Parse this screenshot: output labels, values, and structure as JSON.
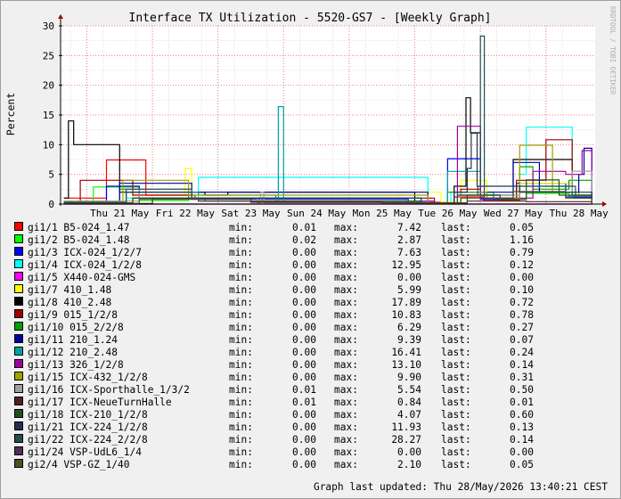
{
  "chart_data": {
    "type": "line",
    "title": "Interface TX Utilization - 5520-GS7 - [Weekly Graph]",
    "ylabel": "Percent",
    "xlabel": "",
    "ylim": [
      0,
      30
    ],
    "yticks": [
      0,
      5,
      10,
      15,
      20,
      25,
      30
    ],
    "xlim": [
      -0.9,
      7.25
    ],
    "x_ticks": [
      {
        "label": "Thu 21 May",
        "day": 0
      },
      {
        "label": "Fri 22 May",
        "day": 1
      },
      {
        "label": "Sat 23 May",
        "day": 2
      },
      {
        "label": "Sun 24 May",
        "day": 3
      },
      {
        "label": "Mon 25 May",
        "day": 4
      },
      {
        "label": "Tue 26 May",
        "day": 5
      },
      {
        "label": "Wed 27 May",
        "day": 6
      },
      {
        "label": "Thu 28 May",
        "day": 7
      }
    ],
    "grid": true,
    "watermark": "RRDTOOL / TOBI OETIKER",
    "series": [
      {
        "name": "gi1/1 B5-024_1.47",
        "color": "#FF0000",
        "min": "0.01",
        "max": "7.42",
        "last": "0.05",
        "x": [
          -0.85,
          -0.2,
          0.4,
          1.15,
          4.6,
          5.1,
          5.55,
          6.1,
          6.9,
          7.2
        ],
        "y": [
          1.0,
          7.42,
          1.5,
          1.0,
          0.3,
          1.2,
          0.6,
          2.0,
          1.0,
          0.05
        ]
      },
      {
        "name": "gi1/2 B5-024_1.48",
        "color": "#00FF00",
        "min": "0.02",
        "max": "2.87",
        "last": "1.16",
        "x": [
          -0.85,
          -0.4,
          0.3,
          1.05,
          4.5,
          5.15,
          5.7,
          6.2,
          6.85,
          7.2
        ],
        "y": [
          0.5,
          2.87,
          0.6,
          1.0,
          0.2,
          1.5,
          0.8,
          1.8,
          1.4,
          1.16
        ]
      },
      {
        "name": "gi1/3 ICX-024_1/2/7",
        "color": "#0000FF",
        "min": "0.00",
        "max": "7.63",
        "last": "0.79",
        "x": [
          -0.85,
          -0.2,
          0.3,
          1.1,
          4.4,
          5.0,
          5.5,
          6.05,
          6.8,
          7.2
        ],
        "y": [
          0.2,
          3.0,
          1.0,
          0.8,
          0.2,
          7.63,
          0.8,
          3.5,
          1.2,
          0.79
        ]
      },
      {
        "name": "gi1/4 ICX-024_1/2/8",
        "color": "#00FFFF",
        "min": "0.00",
        "max": "12.95",
        "last": "0.12",
        "x": [
          -0.85,
          0.1,
          1.2,
          4.7,
          5.05,
          5.6,
          6.1,
          6.2,
          6.9,
          7.2
        ],
        "y": [
          0.1,
          1.0,
          4.5,
          0.2,
          2.0,
          1.0,
          5.0,
          12.95,
          1.0,
          0.12
        ]
      },
      {
        "name": "gi1/5 X440-024-GMS",
        "color": "#FF00FF",
        "min": "0.00",
        "max": "0.00",
        "last": "0.00",
        "x": [
          -0.85,
          7.2
        ],
        "y": [
          0.0,
          0.0
        ]
      },
      {
        "name": "gi1/7 410_1.48",
        "color": "#FFFF00",
        "min": "0.00",
        "max": "5.99",
        "last": "0.10",
        "x": [
          -0.85,
          0.2,
          1.0,
          1.1,
          4.9,
          5.2,
          5.6,
          6.1,
          6.9,
          7.2
        ],
        "y": [
          0.5,
          1.5,
          5.99,
          2.0,
          0.3,
          4.0,
          1.0,
          3.5,
          1.0,
          0.1
        ]
      },
      {
        "name": "gi1/8 410_2.48",
        "color": "#000000",
        "min": "0.00",
        "max": "17.89",
        "last": "0.72",
        "x": [
          -0.85,
          -0.78,
          -0.7,
          0.0,
          1.3,
          1.65,
          4.5,
          5.1,
          5.28,
          5.35,
          5.5,
          6.0,
          6.9,
          7.2
        ],
        "y": [
          1.0,
          14.0,
          10.0,
          2.0,
          1.5,
          2.0,
          0.1,
          3.0,
          17.89,
          12.0,
          1.5,
          7.5,
          1.0,
          0.72
        ]
      },
      {
        "name": "gi1/9 015_1/2/8",
        "color": "#A00000",
        "min": "0.00",
        "max": "10.83",
        "last": "0.78",
        "x": [
          -0.85,
          -0.6,
          0.2,
          1.1,
          4.8,
          5.2,
          5.5,
          6.05,
          6.5,
          6.9,
          7.2
        ],
        "y": [
          0.3,
          4.0,
          1.5,
          1.0,
          0.2,
          2.5,
          1.0,
          4.0,
          10.83,
          1.5,
          0.78
        ]
      },
      {
        "name": "gi1/10 015_2/2/8",
        "color": "#00A000",
        "min": "0.00",
        "max": "6.29",
        "last": "0.27",
        "x": [
          -0.85,
          0.0,
          1.05,
          4.6,
          5.0,
          5.7,
          6.1,
          6.3,
          6.85,
          7.2
        ],
        "y": [
          0.3,
          2.5,
          1.0,
          0.2,
          2.0,
          1.0,
          6.29,
          2.5,
          4.0,
          0.27
        ]
      },
      {
        "name": "gi1/11 210_1.24",
        "color": "#0000A0",
        "min": "0.00",
        "max": "9.39",
        "last": "0.07",
        "x": [
          -0.85,
          0.0,
          1.1,
          4.7,
          5.2,
          6.0,
          6.4,
          7.0,
          7.08,
          7.2
        ],
        "y": [
          0.2,
          3.5,
          2.0,
          0.1,
          2.0,
          7.0,
          2.0,
          5.0,
          9.39,
          0.07
        ]
      },
      {
        "name": "gi1/12 210_2.48",
        "color": "#00A0A0",
        "min": "0.00",
        "max": "16.41",
        "last": "0.24",
        "x": [
          -0.85,
          0.1,
          1.2,
          2.38,
          2.42,
          2.5,
          4.7,
          5.0,
          5.5,
          6.1,
          6.9,
          7.2
        ],
        "y": [
          0.3,
          2.0,
          1.5,
          0.5,
          16.41,
          0.3,
          0.2,
          5.5,
          1.0,
          3.0,
          1.0,
          0.24
        ]
      },
      {
        "name": "gi1/13 326_1/2/8",
        "color": "#A000A0",
        "min": "0.00",
        "max": "13.10",
        "last": "0.14",
        "x": [
          -0.85,
          0.2,
          1.2,
          4.8,
          5.15,
          5.5,
          6.3,
          6.8,
          7.05,
          7.2
        ],
        "y": [
          0.2,
          1.0,
          0.5,
          0.1,
          13.1,
          1.0,
          5.5,
          5.0,
          9.0,
          0.14
        ]
      },
      {
        "name": "gi1/15 ICX-432_1/2/8",
        "color": "#A0A000",
        "min": "0.00",
        "max": "9.90",
        "last": "0.31",
        "x": [
          -0.85,
          0.05,
          1.05,
          4.7,
          5.2,
          5.6,
          6.1,
          6.6,
          7.0,
          7.2
        ],
        "y": [
          0.5,
          4.0,
          1.5,
          0.2,
          2.0,
          1.0,
          9.9,
          2.0,
          1.5,
          0.31
        ]
      },
      {
        "name": "gi1/16 ICX-Sporthalle_1/3/2",
        "color": "#A0A0A0",
        "min": "0.01",
        "max": "5.54",
        "last": "0.50",
        "x": [
          -0.85,
          0.3,
          1.1,
          2.1,
          2.15,
          2.2,
          4.7,
          5.2,
          6.1,
          6.9,
          7.2
        ],
        "y": [
          0.5,
          2.5,
          1.0,
          0.2,
          2.0,
          0.2,
          0.2,
          1.5,
          2.0,
          5.54,
          0.5
        ]
      },
      {
        "name": "gi1/17 ICX-NeueTurnHalle",
        "color": "#502020",
        "min": "0.01",
        "max": "0.84",
        "last": "0.01",
        "x": [
          -0.85,
          0.5,
          2.0,
          4.0,
          5.3,
          6.2,
          7.2
        ],
        "y": [
          0.1,
          0.84,
          0.3,
          0.2,
          0.5,
          0.4,
          0.01
        ]
      },
      {
        "name": "gi1/18 ICX-210_1/2/8",
        "color": "#205020",
        "min": "0.00",
        "max": "4.07",
        "last": "0.60",
        "x": [
          -0.85,
          0.2,
          1.3,
          4.6,
          5.3,
          5.8,
          6.2,
          6.7,
          7.2
        ],
        "y": [
          0.2,
          1.0,
          0.5,
          0.1,
          1.5,
          0.8,
          4.07,
          1.5,
          0.6
        ]
      },
      {
        "name": "gi1/21 ICX-224_1/2/8",
        "color": "#203050",
        "min": "0.00",
        "max": "11.93",
        "last": "0.13",
        "x": [
          -0.85,
          0.1,
          1.1,
          4.6,
          5.1,
          5.3,
          5.36,
          5.45,
          6.1,
          7.2
        ],
        "y": [
          0.2,
          2.0,
          1.0,
          0.1,
          2.0,
          6.0,
          11.93,
          3.0,
          2.0,
          0.13
        ]
      },
      {
        "name": "gi1/22 ICX-224_2/2/8",
        "color": "#205050",
        "min": "0.00",
        "max": "28.27",
        "last": "0.14",
        "x": [
          -0.85,
          0.1,
          1.1,
          4.6,
          5.15,
          5.46,
          5.5,
          5.56,
          6.0,
          6.95,
          7.2
        ],
        "y": [
          0.3,
          2.5,
          1.0,
          0.1,
          1.5,
          3.0,
          28.27,
          1.0,
          3.0,
          1.0,
          0.14
        ]
      },
      {
        "name": "gi1/24 VSP-UdL6_1/4",
        "color": "#503050",
        "min": "0.00",
        "max": "0.00",
        "last": "0.00",
        "x": [
          -0.85,
          7.2
        ],
        "y": [
          0.0,
          0.0
        ]
      },
      {
        "name": "gi2/4 VSP-GZ_1/40",
        "color": "#505020",
        "min": "0.00",
        "max": "2.10",
        "last": "0.05",
        "x": [
          -0.85,
          0.3,
          1.2,
          4.5,
          5.2,
          6.0,
          6.8,
          7.2
        ],
        "y": [
          0.1,
          0.8,
          0.5,
          0.1,
          1.0,
          2.1,
          1.0,
          0.05
        ]
      }
    ]
  },
  "legend": {
    "min_label": "min:",
    "max_label": "max:",
    "last_label": "last:"
  },
  "footer": {
    "updated": "Graph last updated: Thu 28/May/2026 13:40:21 CEST"
  }
}
